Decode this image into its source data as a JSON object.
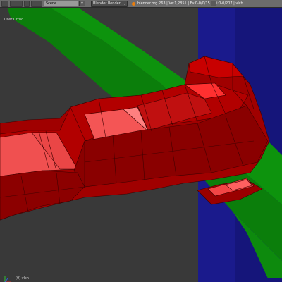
{
  "header": {
    "scene_value": "Scene",
    "render_engine": "Blender Render",
    "stats": "blender.org 263 | Ve:1,2851 | Fa:0-0/0/15 | Tri:0-0/207 | vlch",
    "close_glyph": "×"
  },
  "viewport": {
    "view_name": "User Ortho",
    "object_name": "(0) vlch"
  },
  "colors": {
    "header_bg": "#6c6c6c",
    "viewport_bg": "#393939",
    "blue_plane": "#1a1a8c",
    "green_strip": "#0d8a0d",
    "mesh_red": "#a80000",
    "mesh_highlight": "#f05050"
  },
  "icons": {
    "editor_type": "3d-view-editor-icon",
    "blender_logo": "blender-logo-icon",
    "axis": "axis-gizmo-icon"
  }
}
